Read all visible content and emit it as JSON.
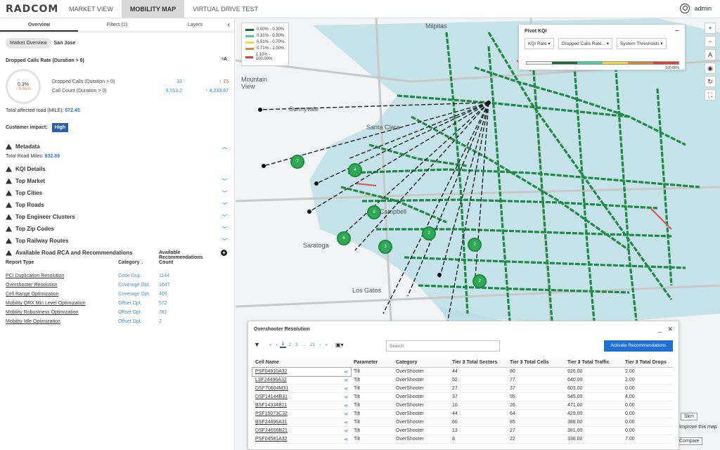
{
  "app": {
    "logo": "RADCOM",
    "tabs": [
      "MARKET VIEW",
      "MOBILITY MAP",
      "VIRTUAL DRIVE TEST"
    ],
    "active_tab": "MOBILITY MAP",
    "user": "admin"
  },
  "left": {
    "subtabs": [
      "Overview",
      "Filters  (1)",
      "Layers"
    ],
    "chips": {
      "market": "Market Overview",
      "city": "San Jose"
    },
    "kpi": {
      "title": "Dropped Calls Rate (Duration > 0)",
      "gauge_value": "0.3%",
      "gauge_delta": "↑ 0.01%",
      "lines": [
        {
          "label": "Dropped Calls (Duration > 0)",
          "value": "33",
          "delta": "↑ 15"
        },
        {
          "label": "Call Count (Duration > 0)",
          "value": "9,053.2",
          "delta": "↑ 4,233.67"
        }
      ],
      "total_label": "Total affected road (MILE):",
      "total_value": "572.45"
    },
    "impact_label": "Customer impact:",
    "impact_value": "High",
    "metadata_title": "Metadata",
    "metadata_label": "Total Road Miles:",
    "metadata_value": "832.89",
    "sections": [
      "KQI Details",
      "Top Market",
      "Top Cities",
      "Top Roads",
      "Top Engineer Clusters",
      "Top Zip Codes",
      "Top Railway Routes",
      "Available Road RCA and Recommendations"
    ],
    "report_table": {
      "headers": [
        "Report Type",
        "Category ↓",
        "Available Recommendations Count"
      ],
      "rows": [
        [
          "PCI Duplication Resolution",
          "Code Dup.",
          "1144"
        ],
        [
          "Overshooter Resolution",
          "Coverage Opt.",
          "1047"
        ],
        [
          "Cell Range Optimization",
          "Coverage Opt.",
          "405"
        ],
        [
          "Mobility QRX Min Level Optimization",
          "Offset Opt.",
          "572"
        ],
        [
          "Mobility Robustness Optimization",
          "Offset Opt.",
          "781"
        ],
        [
          "Mobility Idle Optimization",
          "Offset Opt.",
          "2"
        ]
      ]
    }
  },
  "map": {
    "legend": [
      {
        "label": "0.00% - 0.30%",
        "color": "#1a6b35"
      },
      {
        "label": "0.31% - 0.50%",
        "color": "#4ecba0"
      },
      {
        "label": "0.51% - 0.70%",
        "color": "#e8d84a"
      },
      {
        "label": "0.71% - 1.00%",
        "color": "#d08a40"
      },
      {
        "label": "1.10% - 100.00%",
        "color": "#d94040"
      }
    ],
    "places": [
      "Milpitas",
      "Mountain View",
      "Sunnyvale",
      "Santa Clara",
      "Campbell",
      "Saratoga",
      "Los Gatos"
    ],
    "clusters": [
      "7",
      "4",
      "8",
      "6",
      "3",
      "2",
      "2",
      "2"
    ],
    "pivot": {
      "title": "Pivot KQI",
      "selects": [
        "KQI Rate",
        "Dropped Calls Rate...",
        "System Thresholds"
      ],
      "max": "100.00%"
    },
    "bottom_labels": [
      "Skm",
      "Improve this map",
      "Compare"
    ]
  },
  "panel": {
    "title": "Overshooter Resolution",
    "pages": [
      "«",
      "‹",
      "1",
      "2",
      "3",
      "...",
      "21",
      "›",
      "»"
    ],
    "search_placeholder": "Search",
    "action_label": "Activate Recommendations",
    "columns": [
      "Cell Name",
      "Parameter",
      "Category",
      "Tier 3 Total Sectors",
      "Tier 3 Total Cells",
      "Tier 3 Total Traffic",
      "Tier 3 Total Drops"
    ],
    "rows": [
      [
        "PSF04910A32",
        "Tilt",
        "OverShooter",
        "44",
        "80",
        "926.00",
        "2.00"
      ],
      [
        "LSF24496A32",
        "Tilt",
        "OverShooter",
        "52",
        "77",
        "640.00",
        "2.00"
      ],
      [
        "DSF70604M31",
        "Tilt",
        "OverShooter",
        "27",
        "37",
        "603.00",
        "0.00"
      ],
      [
        "DSF14144B31",
        "Tilt",
        "OverShooter",
        "37",
        "55",
        "545.00",
        "4.00"
      ],
      [
        "BSF14334B11",
        "Tilt",
        "OverShooter",
        "10",
        "26",
        "471.00",
        "0.00"
      ],
      [
        "PSF15073C32",
        "Tilt",
        "OverShooter",
        "44",
        "64",
        "429.00",
        "0.00"
      ],
      [
        "BSF24496A31",
        "Tilt",
        "OverShooter",
        "60",
        "85",
        "388.00",
        "0.00"
      ],
      [
        "DSF24656B21",
        "Tilt",
        "OverShooter",
        "13",
        "27",
        "381.00",
        "0.00"
      ],
      [
        "PSF04581A32",
        "Tilt",
        "OverShooter",
        "8",
        "22",
        "338.00",
        "7.00"
      ]
    ]
  }
}
